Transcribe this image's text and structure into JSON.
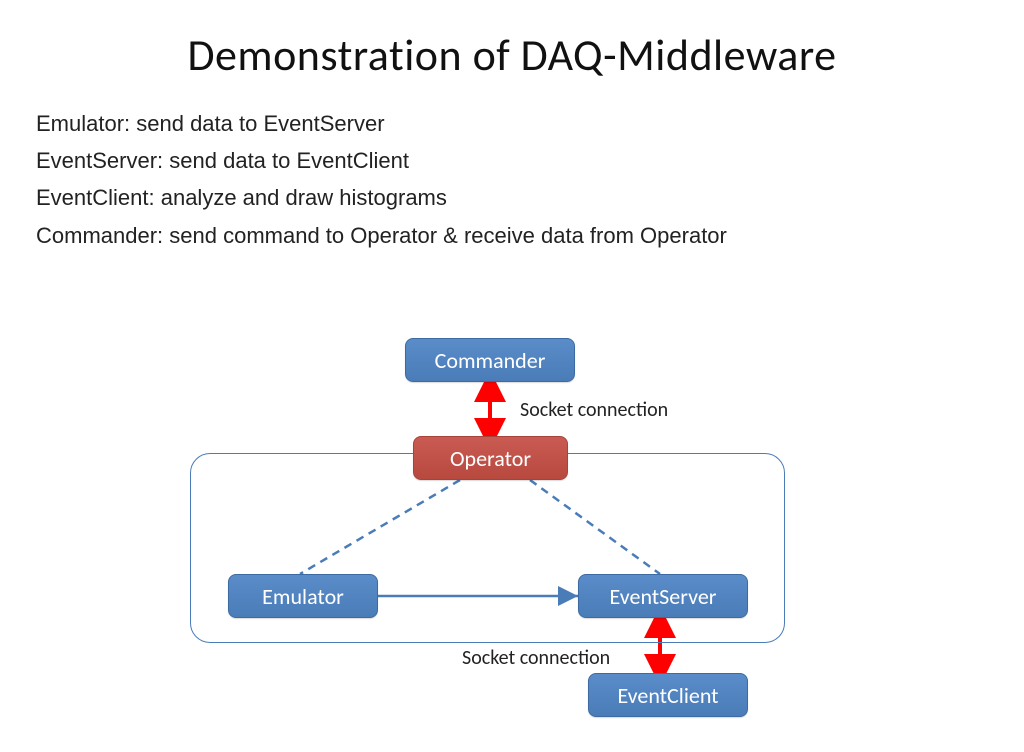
{
  "title": "Demonstration of DAQ-Middleware",
  "descriptions": {
    "emulator": "Emulator: send data to EventServer",
    "eventserver": "EventServer: send data to EventClient",
    "eventclient": "EventClient: analyze and draw histograms",
    "commander": "Commander: send command to Operator & receive data from Operator"
  },
  "nodes": {
    "commander": "Commander",
    "operator": "Operator",
    "emulator": "Emulator",
    "eventserver": "EventServer",
    "eventclient": "EventClient"
  },
  "labels": {
    "socket1": "Socket connection",
    "socket2": "Socket connection"
  },
  "colors": {
    "blue": "#4A7CB8",
    "red": "#B8493F",
    "arrowRed": "#FF0000"
  }
}
